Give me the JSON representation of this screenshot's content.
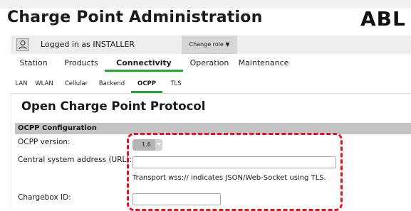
{
  "app": {
    "title": "Charge Point Administration",
    "brand": "ABL"
  },
  "user_bar": {
    "logged_in_text": "Logged in as INSTALLER",
    "change_role_label": "Change role ▼"
  },
  "main_tabs": [
    {
      "label": "Station"
    },
    {
      "label": "Products"
    },
    {
      "label": "Connectivity",
      "active": true
    },
    {
      "label": "Operation"
    },
    {
      "label": "Maintenance"
    }
  ],
  "sub_tabs": [
    {
      "label": "LAN"
    },
    {
      "label": "WLAN"
    },
    {
      "label": "Cellular"
    },
    {
      "label": "Backend"
    },
    {
      "label": "OCPP",
      "active": true
    },
    {
      "label": "TLS"
    }
  ],
  "page": {
    "title": "Open Charge Point Protocol",
    "section_title": "OCPP Configuration",
    "fields": {
      "ocpp_version": {
        "label": "OCPP version:",
        "value": "1.6"
      },
      "central_system_url": {
        "label": "Central system address (URL):",
        "value": "",
        "hint": "Transport wss:// indicates JSON/Web-Socket using TLS."
      },
      "chargebox_id": {
        "label": "Chargebox ID:",
        "value": ""
      }
    }
  },
  "icons": {
    "user": "user-icon",
    "select_arrow": "chevron-down-icon"
  },
  "colors": {
    "active_tab_underline": "#27a33c",
    "highlight_border": "#e0141e",
    "section_bar": "#c4c4c4"
  }
}
